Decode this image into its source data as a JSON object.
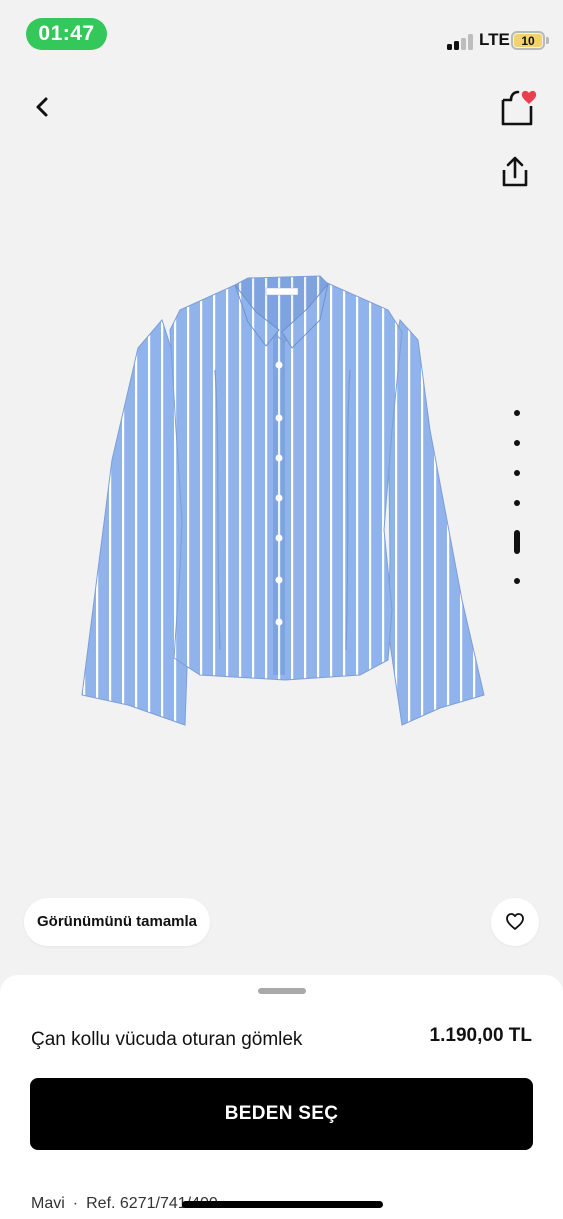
{
  "status_bar": {
    "time": "01:47",
    "network": "LTE",
    "battery": "10",
    "colors": {
      "time_pill": "#34c759",
      "battery_fill": "#f1d36a"
    }
  },
  "nav": {
    "back_icon": "chevron-left-icon",
    "bag_icon": "shopping-bag-icon",
    "share_icon": "share-icon",
    "bag_badge_color": "#e8414d"
  },
  "product": {
    "image_alt_icon": "shirt-image",
    "image_colors": {
      "fabric": "#8fb3ea",
      "stripe": "#ffffff"
    },
    "gallery": {
      "count": 6,
      "active_index": 4
    },
    "complete_look_label": "Görünümünü tamamla",
    "favorite_icon": "heart-icon",
    "name": "Çan kollu vücuda oturan gömlek",
    "price": "1.190,00 TL",
    "size_button_label": "BEDEN SEÇ",
    "color_name": "Mavi",
    "separator": "·",
    "reference": "Ref. 6271/741/400"
  }
}
